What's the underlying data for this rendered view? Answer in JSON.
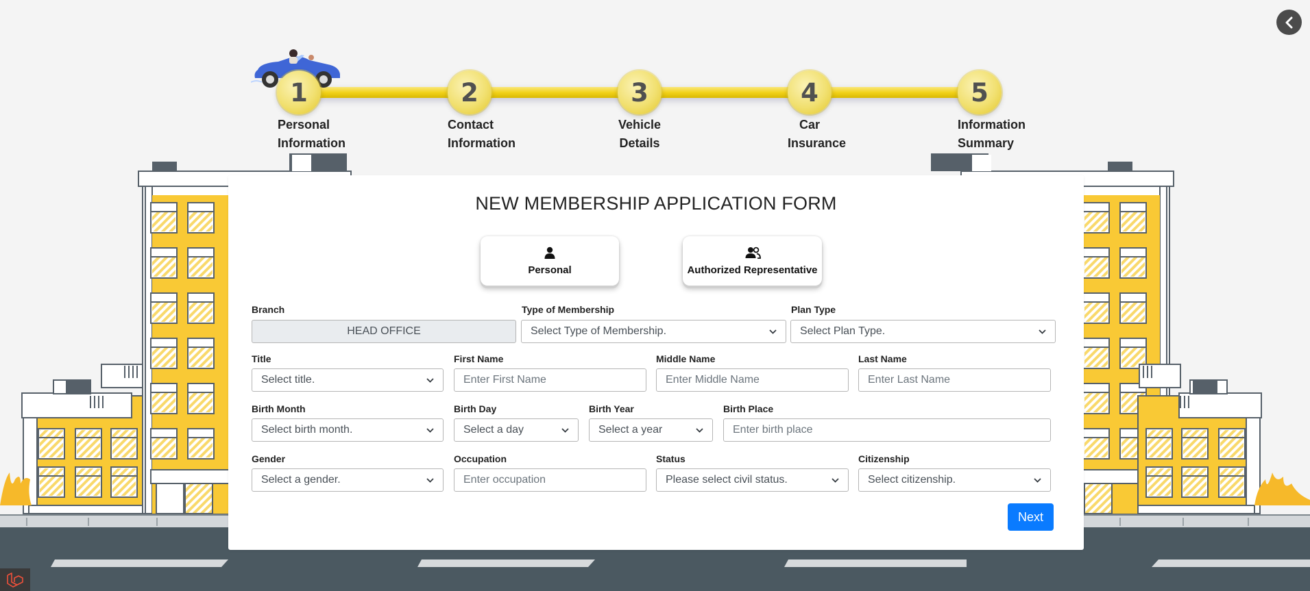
{
  "stepper": {
    "steps": [
      {
        "number": "1",
        "line1": "Personal",
        "line2": "Information"
      },
      {
        "number": "2",
        "line1": "Contact",
        "line2": "Information"
      },
      {
        "number": "3",
        "line1": "Vehicle",
        "line2": "Details"
      },
      {
        "number": "4",
        "line1": "Car",
        "line2": "Insurance"
      },
      {
        "number": "5",
        "line1": "Information",
        "line2": "Summary"
      }
    ]
  },
  "form": {
    "title": "NEW MEMBERSHIP APPLICATION FORM",
    "type_buttons": {
      "personal": "Personal",
      "representative": "Authorized Representative"
    },
    "branch": {
      "label": "Branch",
      "value": "HEAD OFFICE"
    },
    "membership_type": {
      "label": "Type of Membership",
      "value": "Select Type of Membership."
    },
    "plan_type": {
      "label": "Plan Type",
      "value": "Select Plan Type."
    },
    "title_field": {
      "label": "Title",
      "value": "Select title."
    },
    "first_name": {
      "label": "First Name",
      "placeholder": "Enter First Name"
    },
    "middle_name": {
      "label": "Middle Name",
      "placeholder": "Enter Middle Name"
    },
    "last_name": {
      "label": "Last Name",
      "placeholder": "Enter Last Name"
    },
    "birth_month": {
      "label": "Birth Month",
      "value": "Select birth month."
    },
    "birth_day": {
      "label": "Birth Day",
      "value": "Select a day"
    },
    "birth_year": {
      "label": "Birth Year",
      "value": "Select a year"
    },
    "birth_place": {
      "label": "Birth Place",
      "placeholder": "Enter birth place"
    },
    "gender": {
      "label": "Gender",
      "value": "Select a gender."
    },
    "occupation": {
      "label": "Occupation",
      "placeholder": "Enter occupation"
    },
    "status": {
      "label": "Status",
      "value": "Please select civil status."
    },
    "citizenship": {
      "label": "Citizenship",
      "value": "Select citizenship."
    },
    "next_label": "Next"
  },
  "icons": {
    "back": "chevron-left-icon",
    "personal": "person-icon",
    "representative": "people-icon",
    "car": "car-icon",
    "app": "laravel-icon"
  },
  "colors": {
    "accent": "#0a7bff",
    "step_yellow": "#f2d21a",
    "building_yellow": "#f9c935",
    "road": "#4b5961"
  }
}
